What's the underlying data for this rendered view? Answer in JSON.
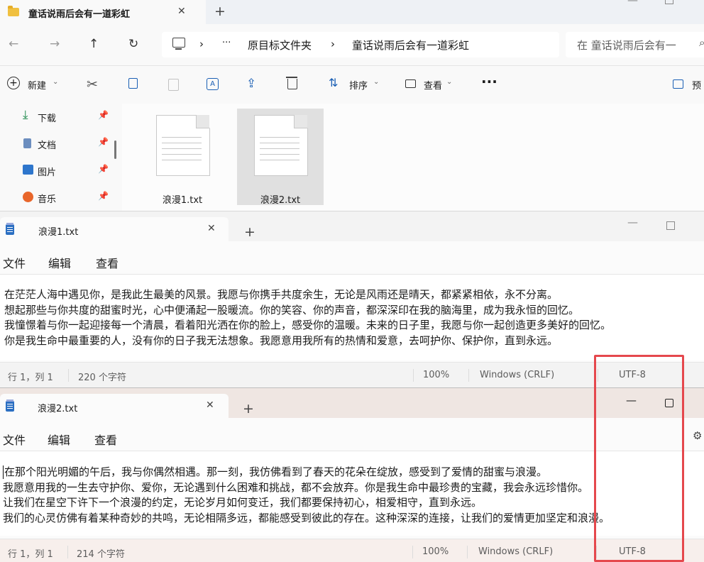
{
  "explorer": {
    "tab_title": "童话说雨后会有一道彩虹",
    "tab_close": "✕",
    "new_tab": "+",
    "nav": {
      "back": "←",
      "forward": "→",
      "up": "↑",
      "refresh": "↻"
    },
    "breadcrumb": {
      "more": "···",
      "sep": "›",
      "root": "原目标文件夹",
      "current": "童话说雨后会有一道彩虹"
    },
    "search_placeholder": "在 童话说雨后会有一",
    "commands": {
      "new_label": "新建",
      "sort_label": "排序",
      "view_label": "查看",
      "more": "···",
      "preview_label": "预"
    },
    "sidebar": {
      "items": [
        {
          "label": "下载",
          "icon": "download-icon"
        },
        {
          "label": "文档",
          "icon": "document-icon"
        },
        {
          "label": "图片",
          "icon": "pictures-icon"
        },
        {
          "label": "音乐",
          "icon": "music-icon"
        }
      ]
    },
    "files": [
      {
        "name": "浪漫1.txt"
      },
      {
        "name": "浪漫2.txt",
        "selected": true
      }
    ]
  },
  "notepad1": {
    "tab_title": "浪漫1.txt",
    "tab_close": "✕",
    "new_tab": "+",
    "menu": [
      "文件",
      "编辑",
      "查看"
    ],
    "lines": [
      "在茫茫人海中遇见你，是我此生最美的风景。我愿与你携手共度余生，无论是风雨还是晴天，都紧紧相依，永不分离。",
      "想起那些与你共度的甜蜜时光，心中便涌起一股暖流。你的笑容、你的声音，都深深印在我的脑海里，成为我永恒的回忆。",
      "我憧憬着与你一起迎接每一个清晨，看着阳光洒在你的脸上，感受你的温暖。未来的日子里，我愿与你一起创造更多美好的回忆。",
      "你是我生命中最重要的人，没有你的日子我无法想象。我愿意用我所有的热情和爱意，去呵护你、保护你，直到永远。"
    ],
    "status": {
      "position": "行 1，列 1",
      "chars": "220 个字符",
      "zoom": "100%",
      "line_ending": "Windows (CRLF)",
      "encoding": "UTF-8"
    }
  },
  "notepad2": {
    "tab_title": "浪漫2.txt",
    "tab_close": "✕",
    "new_tab": "+",
    "menu": [
      "文件",
      "编辑",
      "查看"
    ],
    "lines": [
      "在那个阳光明媚的午后，我与你偶然相遇。那一刻，我仿佛看到了春天的花朵在绽放，感受到了爱情的甜蜜与浪漫。",
      "我愿意用我的一生去守护你、爱你，无论遇到什么困难和挑战，都不会放弃。你是我生命中最珍贵的宝藏，我会永远珍惜你。",
      "让我们在星空下许下一个浪漫的约定，无论岁月如何变迁，我们都要保持初心，相爱相守，直到永远。",
      "我们的心灵仿佛有着某种奇妙的共鸣，无论相隔多远，都能感受到彼此的存在。这种深深的连接，让我们的爱情更加坚定和浪漫。"
    ],
    "status": {
      "position": "行 1，列 1",
      "chars": "214 个字符",
      "zoom": "100%",
      "line_ending": "Windows (CRLF)",
      "encoding": "UTF-8"
    }
  },
  "colors": {
    "highlight_box": "#e5484d",
    "active_titlebar": "#efe6e2",
    "accent": "#2b6fc2"
  }
}
